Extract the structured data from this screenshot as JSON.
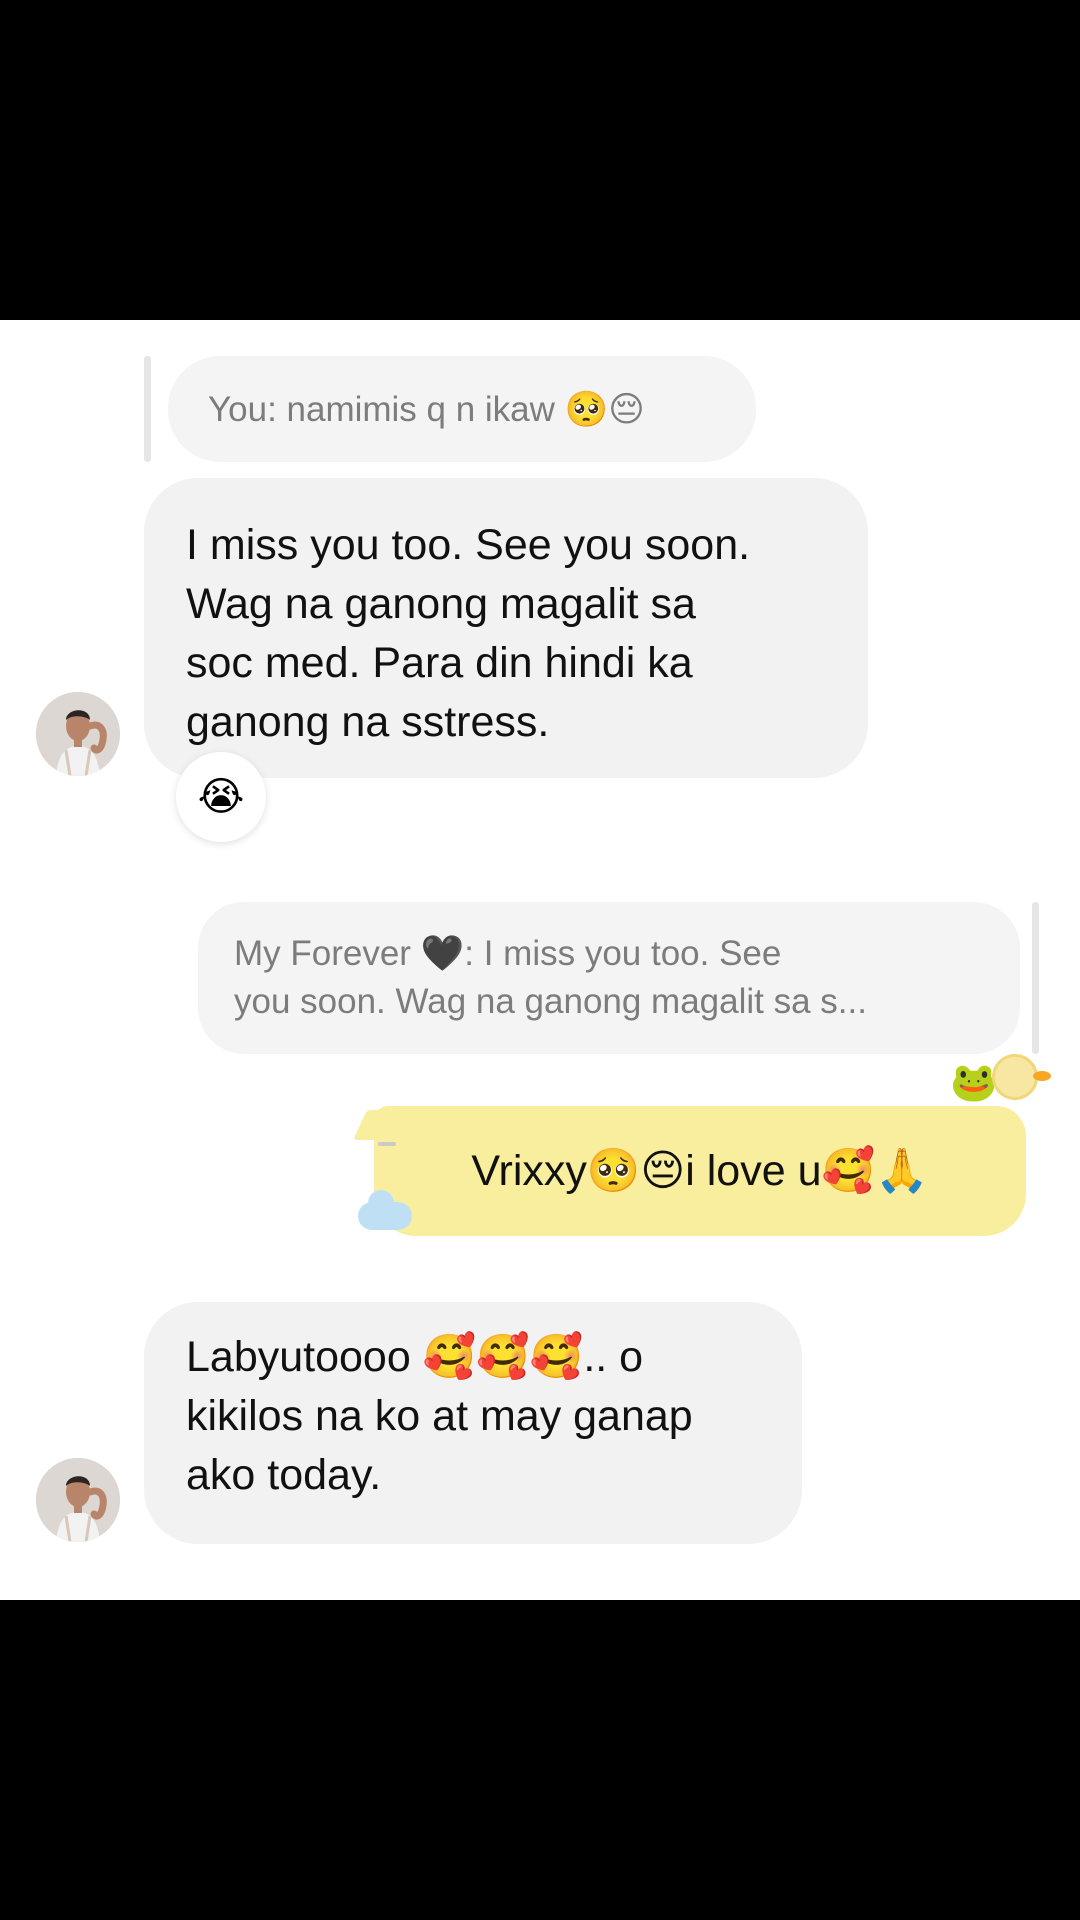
{
  "quoted_reply_1": {
    "text": "You: namimis q n ikaw 🥺😔"
  },
  "message_1": {
    "lines": [
      "I miss you too. See you soon.",
      "Wag na ganong magalit sa",
      "soc med. Para din hindi ka",
      "ganong na sstress."
    ],
    "reaction": "😭"
  },
  "quoted_reply_2": {
    "line1": "My Forever 🖤: I miss you too. See",
    "line2": "you soon. Wag na ganong magalit sa s..."
  },
  "sent_message": {
    "text": "Vrixxy🥺😔i love u🥰🙏",
    "bubble_color": "#f8ee9d",
    "decorations": [
      "frog-icon",
      "duck-icon",
      "cloud-icon"
    ]
  },
  "message_2": {
    "lines": [
      "Labyutoooo 🥰🥰🥰.. o",
      "kikilos na ko at may ganap",
      "ako today."
    ]
  },
  "colors": {
    "received_bubble": "#f2f2f2",
    "quoted_text": "#7c7c7c",
    "background": "#ffffff"
  }
}
